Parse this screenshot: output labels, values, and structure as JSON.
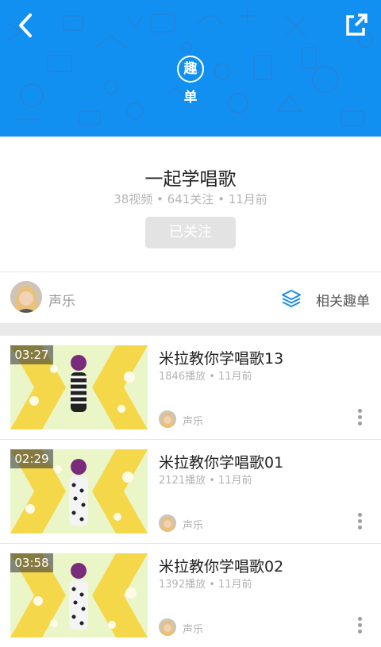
{
  "header": {
    "back_icon": "chevron-left-icon",
    "share_icon": "external-link-icon",
    "logo_char": "趣",
    "logo_word": "单",
    "bg_color": "#1290f2"
  },
  "playlist": {
    "title": "一起学唱歌",
    "meta": "38视频 • 641关注 • 11月前",
    "follow_label": "已关注"
  },
  "tag": {
    "label": "声乐",
    "related_label": "相关趣单",
    "related_icon": "layers-icon"
  },
  "videos": [
    {
      "duration": "03:27",
      "title": "米拉教你学唱歌13",
      "meta": "1846播放 • 11月前",
      "author": "声乐"
    },
    {
      "duration": "02:29",
      "title": "米拉教你学唱歌01",
      "meta": "2121播放 • 11月前",
      "author": "声乐"
    },
    {
      "duration": "03:58",
      "title": "米拉教你学唱歌02",
      "meta": "1392播放 • 11月前",
      "author": "声乐"
    }
  ]
}
